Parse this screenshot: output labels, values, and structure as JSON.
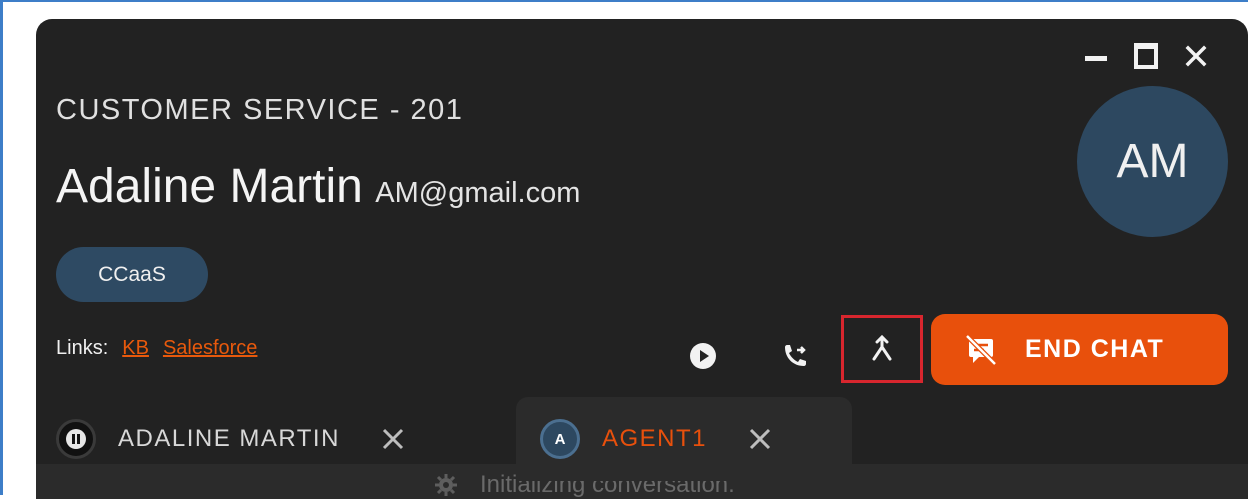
{
  "window": {
    "controls": {
      "minimize_icon": "minimize-icon",
      "maximize_icon": "maximize-icon",
      "close_icon": "close-icon"
    }
  },
  "header": {
    "queue_title": "CUSTOMER SERVICE - 201",
    "contact_name": "Adaline Martin",
    "contact_email": "AM@gmail.com",
    "avatar_initials": "AM",
    "tag": "CCaaS"
  },
  "links": {
    "label": "Links:",
    "items": [
      "KB",
      "Salesforce"
    ]
  },
  "toolbar": {
    "buttons": [
      {
        "icon": "play-icon"
      },
      {
        "icon": "transfer-call-icon"
      },
      {
        "icon": "merge-icon"
      }
    ],
    "end_chat_label": "END CHAT",
    "end_chat_icon": "end-chat-icon"
  },
  "tabs": [
    {
      "badge": "",
      "badge_icon": "pause-icon",
      "label": "ADALINE MARTIN",
      "active": false
    },
    {
      "badge": "A",
      "label": "AGENT1",
      "active": true
    }
  ],
  "status": {
    "text": "Initializing conversation."
  },
  "colors": {
    "panel_bg": "#222222",
    "accent": "#e8500c",
    "avatar_bg": "#2d4860",
    "tag_bg": "#2e4a63",
    "highlight_border": "#d8262e",
    "frame_border": "#3d7ec8"
  }
}
